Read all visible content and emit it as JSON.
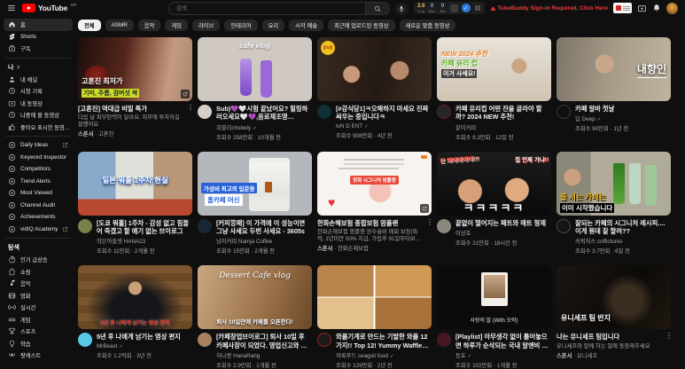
{
  "labels": {
    "sponsor": "스폰서",
    "sep": "·",
    "verified": "✓"
  },
  "colors": {
    "page_bg": "#0f0f0f",
    "brand_red": "#ff0000",
    "warning_red": "#f23c3c",
    "chip_selected_bg": "#f1f1f1"
  },
  "header": {
    "logo_text": "YouTube",
    "logo_region": "KR",
    "search_placeholder": "검색",
    "vidiq_stats": [
      {
        "value": "2.6",
        "label": "0.1y"
      },
      {
        "value": "0",
        "label": "60m"
      },
      {
        "value": "0",
        "label": "48h"
      }
    ],
    "warning_text": "TubeBuddy Sign-in Required, Click Here"
  },
  "sidebar": {
    "primary": [
      "홈",
      "Shorts",
      "구독"
    ],
    "me_header": "나",
    "me_items": [
      "내 채널",
      "시청 기록",
      "내 동영상",
      "나중에 볼 동영상",
      "좋아요 표시한 동영..."
    ],
    "tools": [
      "Daily Ideas",
      "Keyword Inspector",
      "Competitors",
      "Trend Alerts",
      "Most Viewed",
      "Channel Audit",
      "Achievements",
      "vidIQ Academy"
    ],
    "explore_header": "탐색",
    "explore_items": [
      "인기 급상승",
      "쇼핑",
      "음악",
      "영화",
      "실시간",
      "게임",
      "스포츠",
      "학습",
      "팟캐스트"
    ]
  },
  "chips": [
    "전체",
    "ASMR",
    "음악",
    "게임",
    "라이브",
    "인테리어",
    "요리",
    "시각 예술",
    "최근에 업로드된 동영상",
    "새로운 맞춤 동영상"
  ],
  "videos": [
    {
      "title": "[고혼진] 역대급 비밀 특가",
      "desc": "다음 날 피부탄력이 달라요. 피부에 투자하길 잘했어요",
      "sponsor": "고혼진",
      "thumb": {
        "l1": "고혼진 최저가",
        "l2": "기미, 주름, 검버섯 싹"
      }
    },
    {
      "title": "Sub)💜🤍시험 끝났어요? 힐링하러오세요🤍💜,음료제조영상,ASMR,희블리,묻...",
      "channel": "희블리chobely",
      "verified": true,
      "meta": "조회수 258만회 · 10개월 전",
      "thumb": {
        "l1": "cafe vlog"
      }
    },
    {
      "title": "[#강식당1]ㅋ오해하지 마세요 진짜 싸우는 중입니다ㅋ",
      "channel": "tvN D ENT",
      "verified": true,
      "meta": "조회수 908만회 · 4년 전",
      "thumb": {
        "badge": "강식당"
      }
    },
    {
      "title": "카페 유리컵 어떤 잔을 골라야 할까? 2024 NEW 추천!",
      "channel": "같이커피",
      "meta": "조회수 9.3만회 · 12일 전",
      "thumb": {
        "l1": "NEW 2024 추천",
        "l2": "카페 유리 컵",
        "l3": "이거 사세요!"
      }
    },
    {
      "title": "카페 알바 첫날",
      "channel": "딥 Deep",
      "verified": true,
      "meta": "조회수 90만회 · 1년 전",
      "thumb": {
        "l1": "내향인"
      }
    },
    {
      "title": "[도쿄 워홀] 1주차 - 감성 없고 힘들어 죽겠고 할 얘기 없는 브이로그",
      "channel": "작은아들셋 HANA23",
      "meta": "조회수 11만회 · 2개월 전",
      "thumb": {
        "l1": "일본 워홀 1주차 현실"
      }
    },
    {
      "title": "[커피깡패] 이 가격에 이 성능이면 그냥 사세요 두번 사세요 - 3605s",
      "channel": "남자커피 Namja Coffee",
      "meta": "조회수 15만회 · 2개월 전",
      "thumb": {
        "l1": "가성비 최고의 입문용",
        "l2": "홈카페 머신"
      }
    },
    {
      "title": "한화손해보험 종합보험 암플랜",
      "desc": "한화손해보험 암플랜 원수술비 매회 보장(특약, 1년미만 50% 지급, 가입후 91일부터보장)",
      "sponsor": "한화손해보험",
      "thumb": {
        "badge": "한화 시그니처 암플랜"
      }
    },
    {
      "title": "끝없이 떨어지는 패트와 매트 형제",
      "channel": "이상호",
      "meta": "조회수 21만회 · 18시간 전",
      "thumb": {
        "l1": "안 돼에에에에!!!",
        "l2": "집 언제 가냐!!",
        "l3": "ㅋㅋㅋㅋㅋ"
      }
    },
    {
      "title": "잘되는 카페의 시그니처 레시피.... 이게 뭔데 잘 팔려??",
      "channel": "커픽처스 coffictures",
      "meta": "조회수 3.7만회 · 6일 전",
      "thumb": {
        "l1": "줄 서는 카페는",
        "l2": "이미 시작했습니다"
      }
    },
    {
      "title": "5년 후 나에게 남기는 영상 편지",
      "channel": "MrBeast",
      "verified": true,
      "meta": "조회수 1.2억회 · 3년 전",
      "thumb": {
        "l1": "5년 후 나에게 남기는 영상 편지"
      }
    },
    {
      "title": "[카페창업브이로그] 퇴사 10일 후 카페사장이 되었다. 영업신고와 셀프인테리어까...",
      "channel": "하나랑 HanaRang",
      "meta": "조회수 2.9만회 · 1개월 전",
      "thumb": {
        "l1": "Dessert Cafe vlog",
        "l2": "퇴사 10일만에 카페를 오픈한다!"
      }
    },
    {
      "title": "와플기계로 만드는 기발한 와플 12가지!! Top 12! Yummy Waffle Making...",
      "channel": "까룩푸드 seagull food",
      "verified": true,
      "meta": "조회수 129만회 · 2년 전",
      "thumb": {}
    },
    {
      "title": "[Playlist] 아무생각 없이 틀어놓으면 하루가 순삭되는 국내 알앤비 노래모음 플레...",
      "channel": "동포",
      "verified": true,
      "meta": "조회수 102만회 · 1개월 전",
      "thumb": {
        "l1": "사랑의 말 (With 오락)"
      }
    },
    {
      "title": "나는 유니세프 팀입니다",
      "desc": "유니세프와 함께 하는 일에 동참해주세요",
      "sponsor": "유니세프",
      "thumb": {
        "l1": "유니세프 팀 반지"
      }
    }
  ]
}
